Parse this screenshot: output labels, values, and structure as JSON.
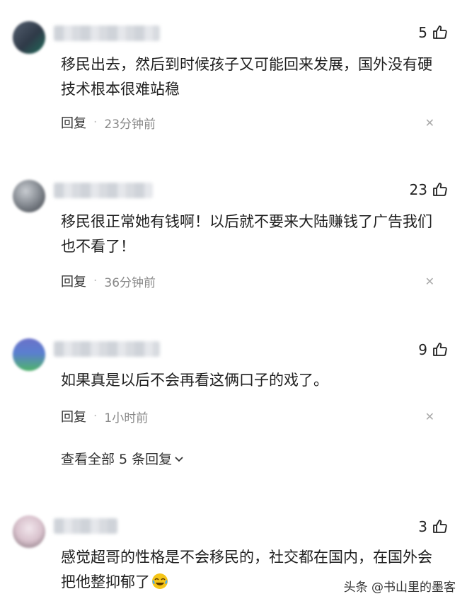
{
  "comments": [
    {
      "likes": "5",
      "text": "移民出去，然后到时候孩子又可能回来发展，国外没有硬技术根本很难站稳",
      "reply_label": "回复",
      "time": "23分钟前"
    },
    {
      "likes": "23",
      "text": "移民很正常她有钱啊！以后就不要来大陆赚钱了广告我们也不看了！",
      "reply_label": "回复",
      "time": "36分钟前"
    },
    {
      "likes": "9",
      "text": "如果真是以后不会再看这俩口子的戏了。",
      "reply_label": "回复",
      "time": "1小时前",
      "view_all": "查看全部 5 条回复"
    },
    {
      "likes": "3",
      "text": "感觉超哥的性格是不会移民的，社交都在国内，在国外会把他整抑郁了",
      "emoji": "crying-laughing-emoji"
    }
  ],
  "watermark": "头条 @书山里的墨客",
  "colors": {
    "text": "#1f1f1f",
    "meta": "#888888",
    "emoji": "#f5c518"
  }
}
